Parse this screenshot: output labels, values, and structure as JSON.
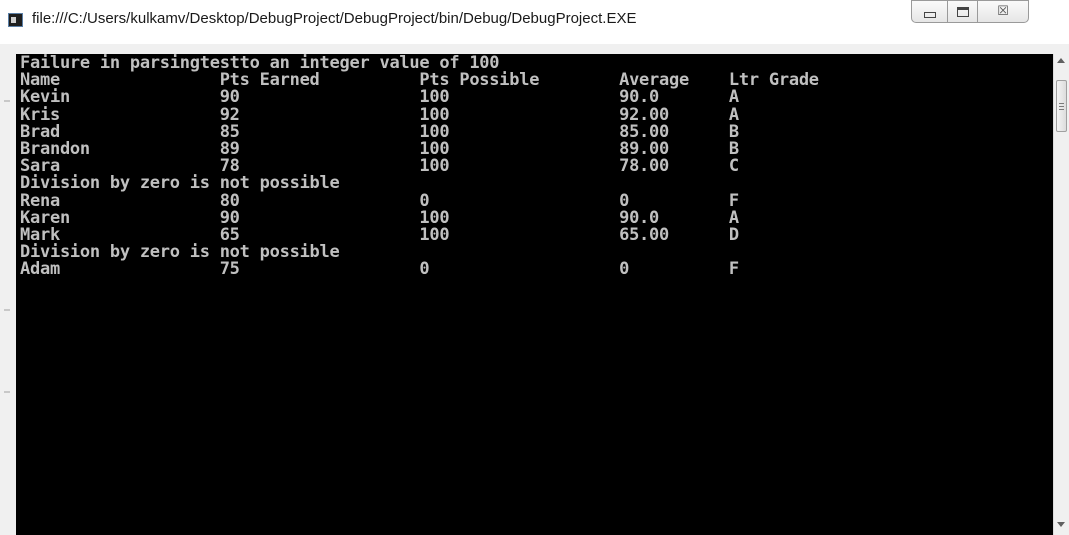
{
  "window": {
    "title": "file:///C:/Users/kulkamv/Desktop/DebugProject/DebugProject/bin/Debug/DebugProject.EXE",
    "icon": "console-app-icon",
    "buttons": {
      "minimize": "minimize-icon",
      "maximize": "maximize-icon",
      "close_glyph": "☒"
    }
  },
  "console": {
    "background": "#000000",
    "text_color": "#c0c0c0",
    "lines": [
      "Failure in parsingtestto an integer value of 100",
      "Name                Pts Earned          Pts Possible        Average    Ltr Grade",
      "Kevin               90                  100                 90.0       A",
      "Kris                92                  100                 92.00      A",
      "Brad                85                  100                 85.00      B",
      "Brandon             89                  100                 89.00      B",
      "Sara                78                  100                 78.00      C",
      "Division by zero is not possible",
      "Rena                80                  0                   0          F",
      "Karen               90                  100                 90.0       A",
      "Mark                65                  100                 65.00      D",
      "Division by zero is not possible",
      "Adam                75                  0                   0          F"
    ]
  },
  "scrollbar": {
    "up_icon": "scroll-up-arrow-icon",
    "down_icon": "scroll-down-arrow-icon"
  }
}
